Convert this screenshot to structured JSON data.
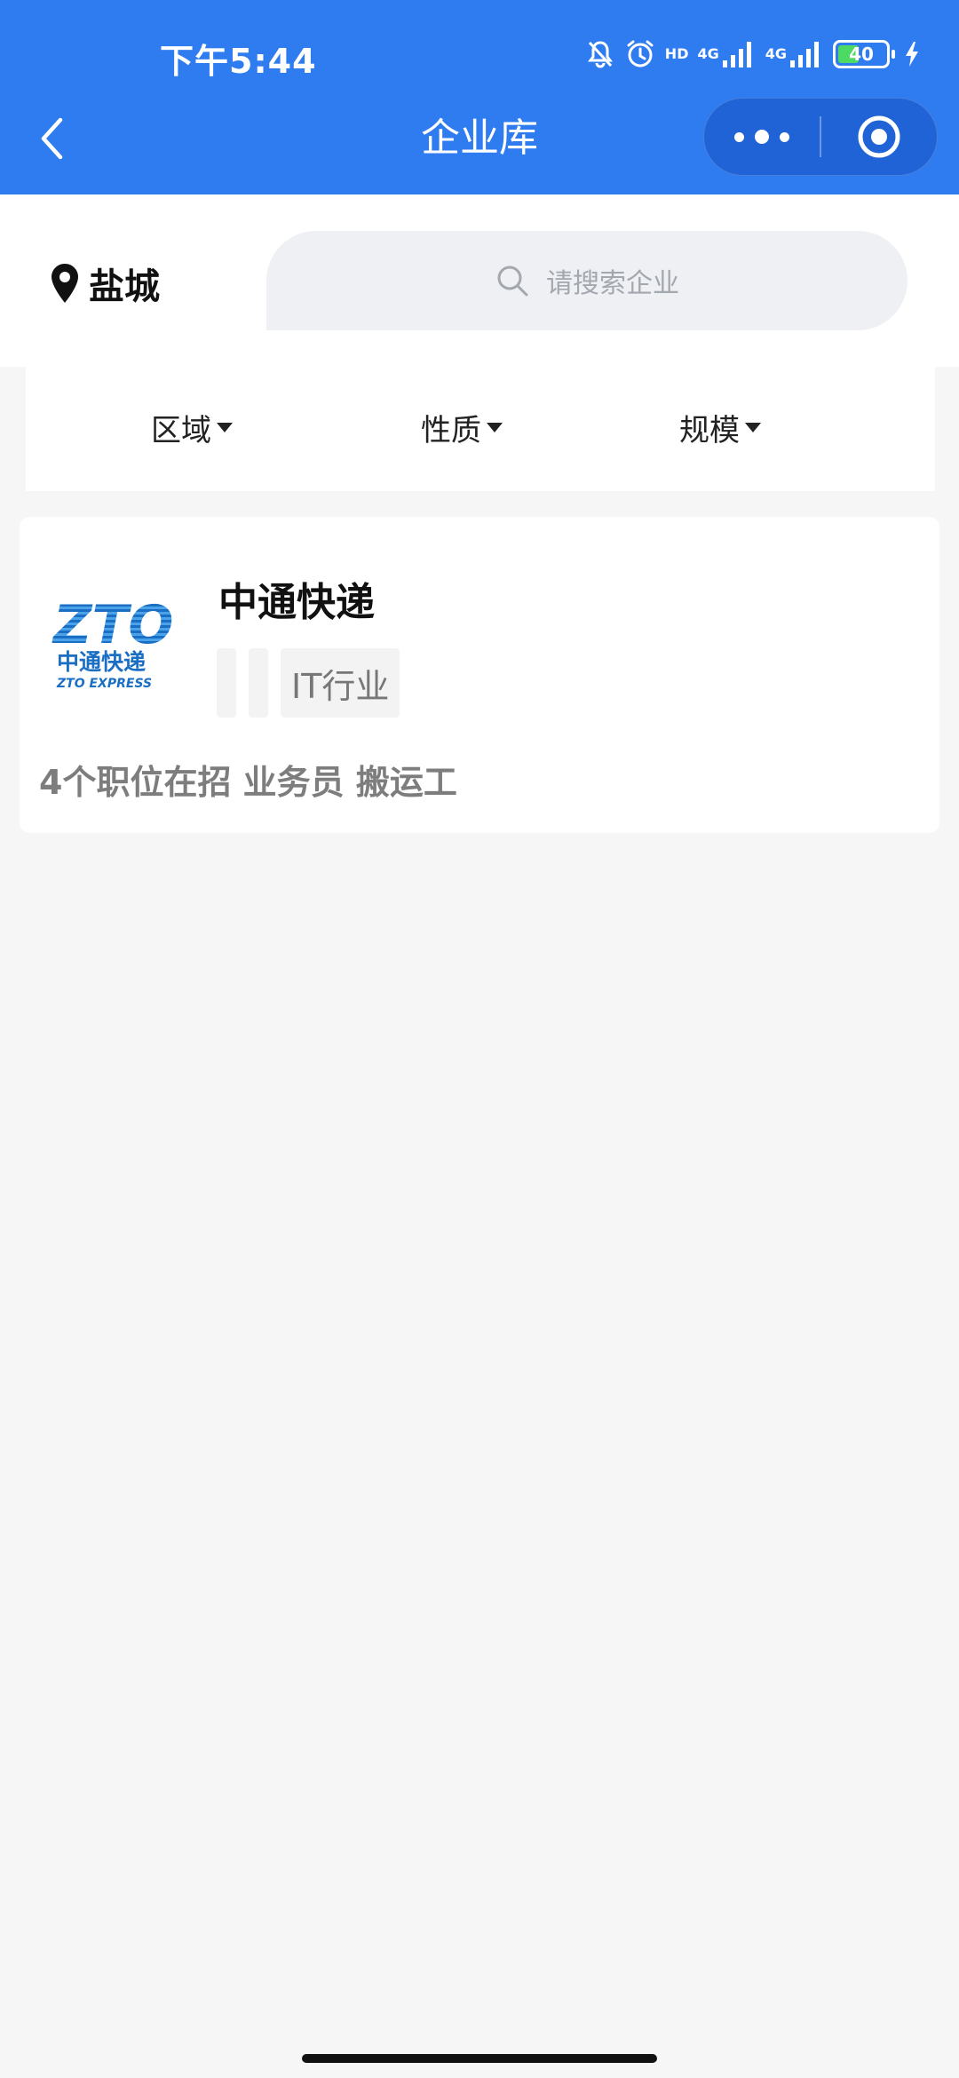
{
  "status_bar": {
    "time": "下午5:44",
    "hd_label": "HD",
    "net1": "4G",
    "net2": "4G",
    "battery": "40"
  },
  "header": {
    "title": "企业库"
  },
  "search": {
    "city": "盐城",
    "placeholder": "请搜索企业"
  },
  "filters": [
    {
      "label": "区域"
    },
    {
      "label": "性质"
    },
    {
      "label": "规模"
    }
  ],
  "companies": [
    {
      "name": "中通快递",
      "tags": [
        "",
        "",
        "IT行业"
      ],
      "jobs_summary": "4个职位在招 业务员 搬运工",
      "logo": {
        "text_top": "ZTO",
        "text_cn": "中通快递",
        "text_en": "ZTO EXPRESS",
        "color": "#1a6fc4"
      }
    }
  ],
  "colors": {
    "header_bg": "#2f7cf0",
    "capsule_bg": "#2063d6",
    "page_bg": "#f6f6f7",
    "battery_fill": "#4cd964"
  }
}
